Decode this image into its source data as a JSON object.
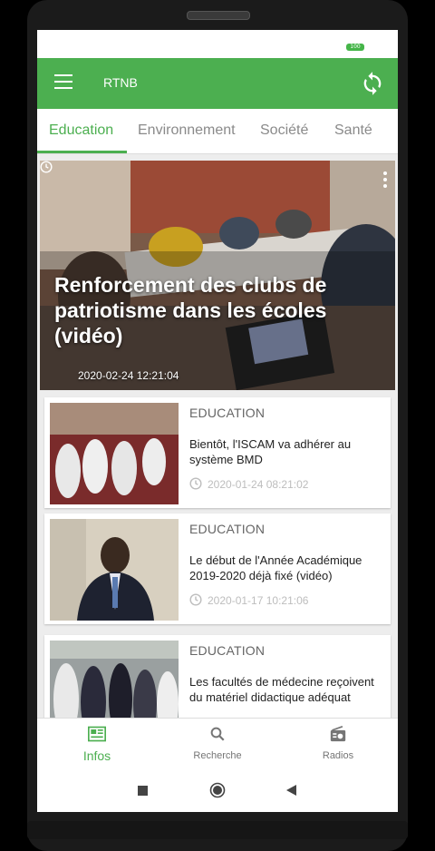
{
  "status": {
    "battery": "100"
  },
  "appbar": {
    "title": "RTNB",
    "menu_icon": "hamburger-menu-icon",
    "refresh_icon": "refresh-icon"
  },
  "tabs": [
    {
      "label": "Education",
      "active": true
    },
    {
      "label": "Environnement",
      "active": false
    },
    {
      "label": "Société",
      "active": false
    },
    {
      "label": "Santé",
      "active": false
    }
  ],
  "hero": {
    "title": "Renforcement des clubs de patriotisme dans les écoles (vidéo)",
    "date": "2020-02-24 12:21:04"
  },
  "articles": [
    {
      "category": "EDUCATION",
      "title": "Bientôt, l'ISCAM va adhérer au système BMD",
      "date": "2020-01-24 08:21:02"
    },
    {
      "category": "EDUCATION",
      "title": "Le début de l'Année Académique 2019-2020 déjà fixé (vidéo)",
      "date": "2020-01-17 10:21:06"
    },
    {
      "category": "EDUCATION",
      "title": "Les facultés de médecine reçoivent du matériel didactique adéquat",
      "date": ""
    }
  ],
  "bottom_nav": [
    {
      "label": "Infos",
      "icon": "newspaper-icon",
      "active": true
    },
    {
      "label": "Recherche",
      "icon": "search-icon",
      "active": false
    },
    {
      "label": "Radios",
      "icon": "radio-icon",
      "active": false
    }
  ],
  "colors": {
    "primary": "#4caf50",
    "text_secondary": "#757575"
  }
}
